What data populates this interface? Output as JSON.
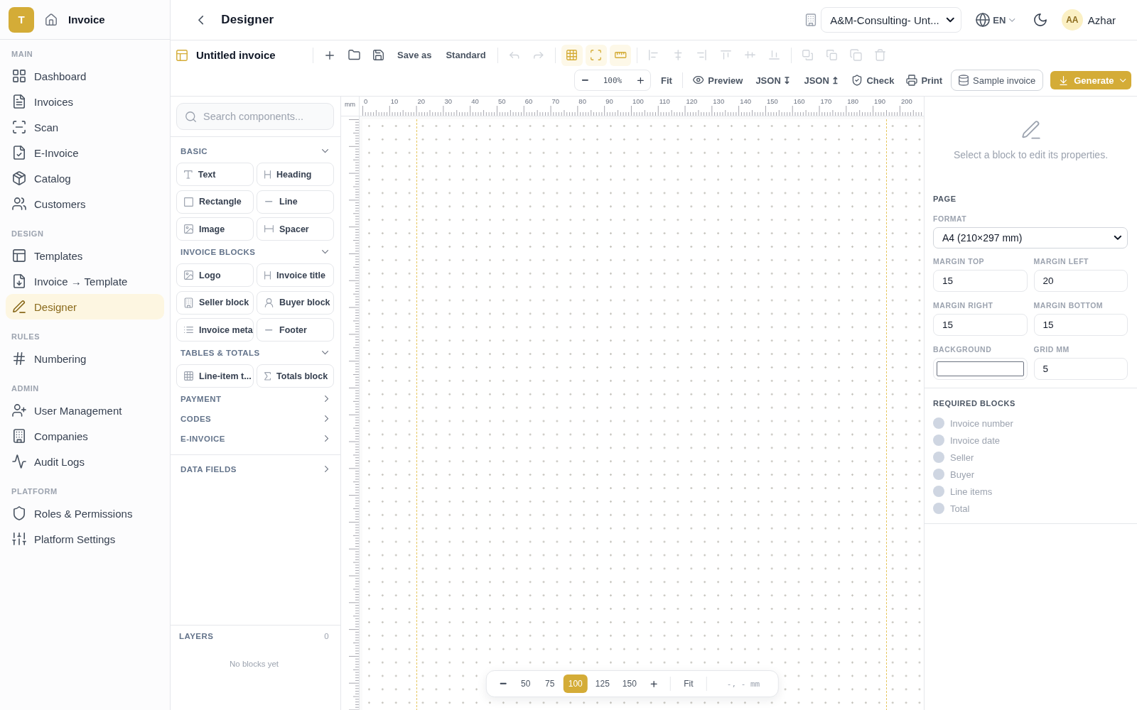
{
  "sidebar": {
    "logo": "T",
    "app_name": "Invoice",
    "sections": [
      {
        "heading": "MAIN",
        "items": [
          {
            "label": "Dashboard",
            "selected": false
          },
          {
            "label": "Invoices",
            "selected": false
          },
          {
            "label": "Scan",
            "selected": false
          },
          {
            "label": "E-Invoice",
            "selected": false
          },
          {
            "label": "Catalog",
            "selected": false
          },
          {
            "label": "Customers",
            "selected": false
          }
        ]
      },
      {
        "heading": "DESIGN",
        "items": [
          {
            "label": "Templates",
            "selected": false
          },
          {
            "label": "Invoice → Template",
            "selected": false
          },
          {
            "label": "Designer",
            "selected": true
          }
        ]
      },
      {
        "heading": "RULES",
        "items": [
          {
            "label": "Numbering",
            "selected": false
          }
        ]
      },
      {
        "heading": "ADMIN",
        "items": [
          {
            "label": "User Management",
            "selected": false
          },
          {
            "label": "Companies",
            "selected": false
          },
          {
            "label": "Audit Logs",
            "selected": false
          }
        ]
      },
      {
        "heading": "PLATFORM",
        "items": [
          {
            "label": "Roles & Permissions",
            "selected": false
          },
          {
            "label": "Platform Settings",
            "selected": false
          }
        ]
      }
    ]
  },
  "header": {
    "title": "Designer",
    "company": "A&M-Consulting- Unt...",
    "language": "EN",
    "user": {
      "initials": "AA",
      "name": "Azhar"
    }
  },
  "toolbar": {
    "document_name": "Untitled invoice",
    "groups": [
      {
        "items": [
          {
            "kind": "icon",
            "disabled": false
          },
          {
            "kind": "icon",
            "disabled": false
          },
          {
            "kind": "icon",
            "disabled": false
          },
          {
            "kind": "text",
            "label": "Save as",
            "disabled": false
          },
          {
            "kind": "text",
            "label": "Standard",
            "disabled": false
          }
        ]
      },
      {
        "items": [
          {
            "kind": "icon",
            "disabled": true
          },
          {
            "kind": "icon",
            "disabled": true
          }
        ]
      },
      {
        "items": [
          {
            "kind": "toggle",
            "on": true
          },
          {
            "kind": "toggle",
            "on": true
          },
          {
            "kind": "toggle",
            "on": true
          }
        ]
      },
      {
        "items": [
          {
            "kind": "icon",
            "disabled": true
          },
          {
            "kind": "icon",
            "disabled": true
          },
          {
            "kind": "icon",
            "disabled": true
          },
          {
            "kind": "icon",
            "disabled": true
          },
          {
            "kind": "icon",
            "disabled": true
          },
          {
            "kind": "icon",
            "disabled": true
          }
        ]
      },
      {
        "items": [
          {
            "kind": "icon",
            "disabled": true
          },
          {
            "kind": "icon",
            "disabled": true
          },
          {
            "kind": "icon",
            "disabled": true
          },
          {
            "kind": "icon",
            "disabled": true
          }
        ]
      }
    ],
    "zoom": {
      "value": "100%",
      "fit": "Fit"
    },
    "actions": [
      {
        "kind": "plain",
        "label": "Preview"
      },
      {
        "kind": "plain",
        "label": "JSON ↧"
      },
      {
        "kind": "plain",
        "label": "JSON ↥"
      },
      {
        "kind": "plain",
        "label": "Check"
      },
      {
        "kind": "plain",
        "label": "Print"
      },
      {
        "kind": "outline",
        "label": "Sample invoice"
      },
      {
        "kind": "primary",
        "label": "Generate"
      }
    ]
  },
  "components": {
    "search_placeholder": "Search components...",
    "groups": [
      {
        "title": "BASIC",
        "expanded": true,
        "items": [
          "Text",
          "Heading",
          "Rectangle",
          "Line",
          "Image",
          "Spacer"
        ]
      },
      {
        "title": "INVOICE BLOCKS",
        "expanded": true,
        "items": [
          "Logo",
          "Invoice title",
          "Seller block",
          "Buyer block",
          "Invoice meta",
          "Footer"
        ]
      },
      {
        "title": "TABLES & TOTALS",
        "expanded": true,
        "items": [
          "Line-item t...",
          "Totals block"
        ]
      },
      {
        "title": "PAYMENT",
        "expanded": false
      },
      {
        "title": "CODES",
        "expanded": false
      },
      {
        "title": "E-INVOICE",
        "expanded": false
      }
    ],
    "data_fields": {
      "title": "DATA FIELDS",
      "expanded": false
    }
  },
  "layers": {
    "title": "LAYERS",
    "count": "0",
    "empty": "No blocks yet"
  },
  "canvas": {
    "ruler": {
      "unit": "mm",
      "labels": [
        "0",
        "10",
        "20",
        "30",
        "40",
        "50",
        "60",
        "70",
        "80",
        "90",
        "100",
        "110",
        "120",
        "130",
        "140",
        "150",
        "160",
        "170",
        "180",
        "190",
        "200"
      ]
    },
    "zoom_bar": {
      "presets": [
        {
          "label": "50",
          "selected": false
        },
        {
          "label": "75",
          "selected": false
        },
        {
          "label": "100",
          "selected": true
        },
        {
          "label": "125",
          "selected": false
        },
        {
          "label": "150",
          "selected": false
        }
      ],
      "fit": "Fit",
      "cursor": "-, - mm"
    }
  },
  "properties": {
    "hint": "Select a block to edit its properties.",
    "page": {
      "title": "PAGE",
      "format": {
        "label": "FORMAT",
        "value": "A4 (210×297 mm)"
      },
      "fields": [
        {
          "label": "MARGIN TOP",
          "kind": "number",
          "value": "15"
        },
        {
          "label": "MARGIN LEFT",
          "kind": "number",
          "value": "20"
        },
        {
          "label": "MARGIN RIGHT",
          "kind": "number",
          "value": "15"
        },
        {
          "label": "MARGIN BOTTOM",
          "kind": "number",
          "value": "15"
        },
        {
          "label": "BACKGROUND",
          "kind": "color"
        },
        {
          "label": "GRID MM",
          "kind": "number",
          "value": "5"
        }
      ]
    },
    "required": {
      "title": "REQUIRED BLOCKS",
      "items": [
        {
          "label": "Invoice number",
          "present": false
        },
        {
          "label": "Invoice date",
          "present": false
        },
        {
          "label": "Seller",
          "present": false
        },
        {
          "label": "Buyer",
          "present": false
        },
        {
          "label": "Line items",
          "present": false
        },
        {
          "label": "Total",
          "present": false
        }
      ]
    }
  }
}
